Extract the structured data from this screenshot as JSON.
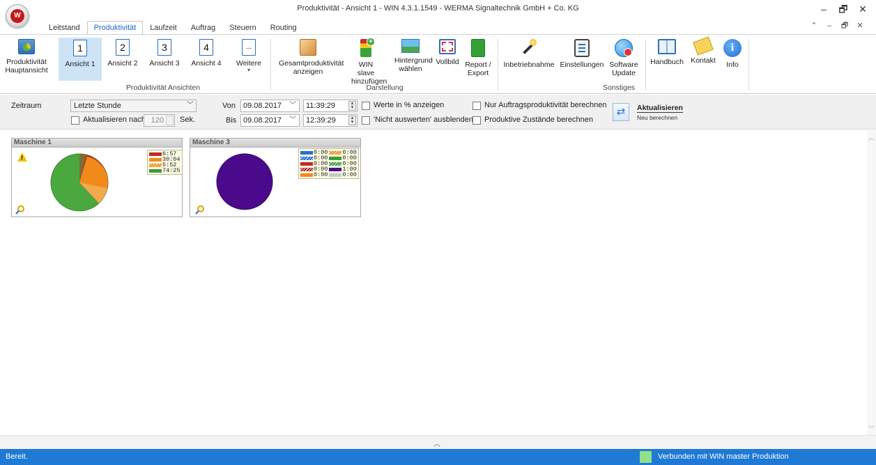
{
  "window": {
    "title": "Produktivität - Ansicht 1 - WIN 4.3.1.1549 - WERMA Signaltechnik GmbH + Co. KG",
    "minimize": "–",
    "restore": "🗗",
    "close": "✕",
    "sub_up": "⌃",
    "sub_min": "–",
    "sub_restore": "🗗",
    "sub_close": "✕"
  },
  "tabs": [
    {
      "label": "Leitstand"
    },
    {
      "label": "Produktivität"
    },
    {
      "label": "Laufzeit"
    },
    {
      "label": "Auftrag"
    },
    {
      "label": "Steuern"
    },
    {
      "label": "Routing"
    }
  ],
  "ribbon": {
    "buttons": {
      "hauptansicht": "Produktivität Hauptansicht",
      "ansicht1": "Ansicht 1",
      "ansicht2": "Ansicht 2",
      "ansicht3": "Ansicht 3",
      "ansicht4": "Ansicht 4",
      "weitere": "Weitere",
      "gesamt": "Gesamtproduktivität anzeigen",
      "winslave": "WIN slave hinzufügen",
      "hintergrund": "Hintergrund wählen",
      "vollbild": "Vollbild",
      "report": "Report / Export",
      "inbetrieb": "Inbetriebnahme",
      "einstellungen": "Einstellungen",
      "software": "Software Update",
      "handbuch": "Handbuch",
      "kontakt": "Kontakt",
      "info": "Info"
    },
    "nums": {
      "n1": "1",
      "n2": "2",
      "n3": "3",
      "n4": "4",
      "dots": "...",
      "caret": "▾"
    },
    "groups": {
      "ansichten": "Produktivität Ansichten",
      "darstellung": "Darstellung",
      "sonstiges": "Sonstiges"
    }
  },
  "controls": {
    "zeitraum_label": "Zeitraum",
    "zeitraum_value": "Letzte Stunde",
    "aktualisieren_nach": "Aktualisieren nach",
    "seconds_value": "120",
    "sek": "Sek.",
    "von": "Von",
    "bis": "Bis",
    "von_date": "09.08.2017",
    "von_time": "11:39:29",
    "bis_date": "09.08.2017",
    "bis_time": "12:39:29",
    "werte_prozent": "Werte in % anzeigen",
    "nicht_auswerten": "'Nicht auswerten' ausblenden",
    "nur_auftrag": "Nur Auftragsproduktivität berechnen",
    "produktive_zustaende": "Produktive Zustände berechnen",
    "aktualisieren": "Aktualisieren",
    "neu_berechnen": "Neu berechnen"
  },
  "machines": [
    {
      "name": "Maschine 1",
      "warning": true,
      "legend": [
        {
          "color": "#c0282d",
          "value": "6:57"
        },
        {
          "color": "#f28a1a",
          "value": "30:04"
        },
        {
          "color": "#f28a1a",
          "hatched": true,
          "value": "5:52"
        },
        {
          "color": "#3e9a3a",
          "value": "74:25"
        }
      ]
    },
    {
      "name": "Maschine 3",
      "legend_left": [
        {
          "color": "#2a6fd6",
          "value": "0:00"
        },
        {
          "color": "#2a6fd6",
          "hatched": true,
          "value": "0:00"
        },
        {
          "color": "#c0282d",
          "value": "0:00"
        },
        {
          "color": "#c0282d",
          "hatched": true,
          "value": "0:00"
        },
        {
          "color": "#f28a1a",
          "value": "0:00"
        }
      ],
      "legend_right": [
        {
          "color": "#f28a1a",
          "hatched": true,
          "value": "0:00"
        },
        {
          "color": "#3e9a3a",
          "value": "0:00"
        },
        {
          "color": "#3e9a3a",
          "hatched": true,
          "value": "0:00"
        },
        {
          "color": "#4b0a8c",
          "value": "1:00"
        },
        {
          "color": "#c8c8c8",
          "value": "0:00"
        }
      ]
    }
  ],
  "status": {
    "left": "Bereit.",
    "right": "Verbunden mit WIN master Produktion",
    "indicator_color": "#8fe08a"
  }
}
